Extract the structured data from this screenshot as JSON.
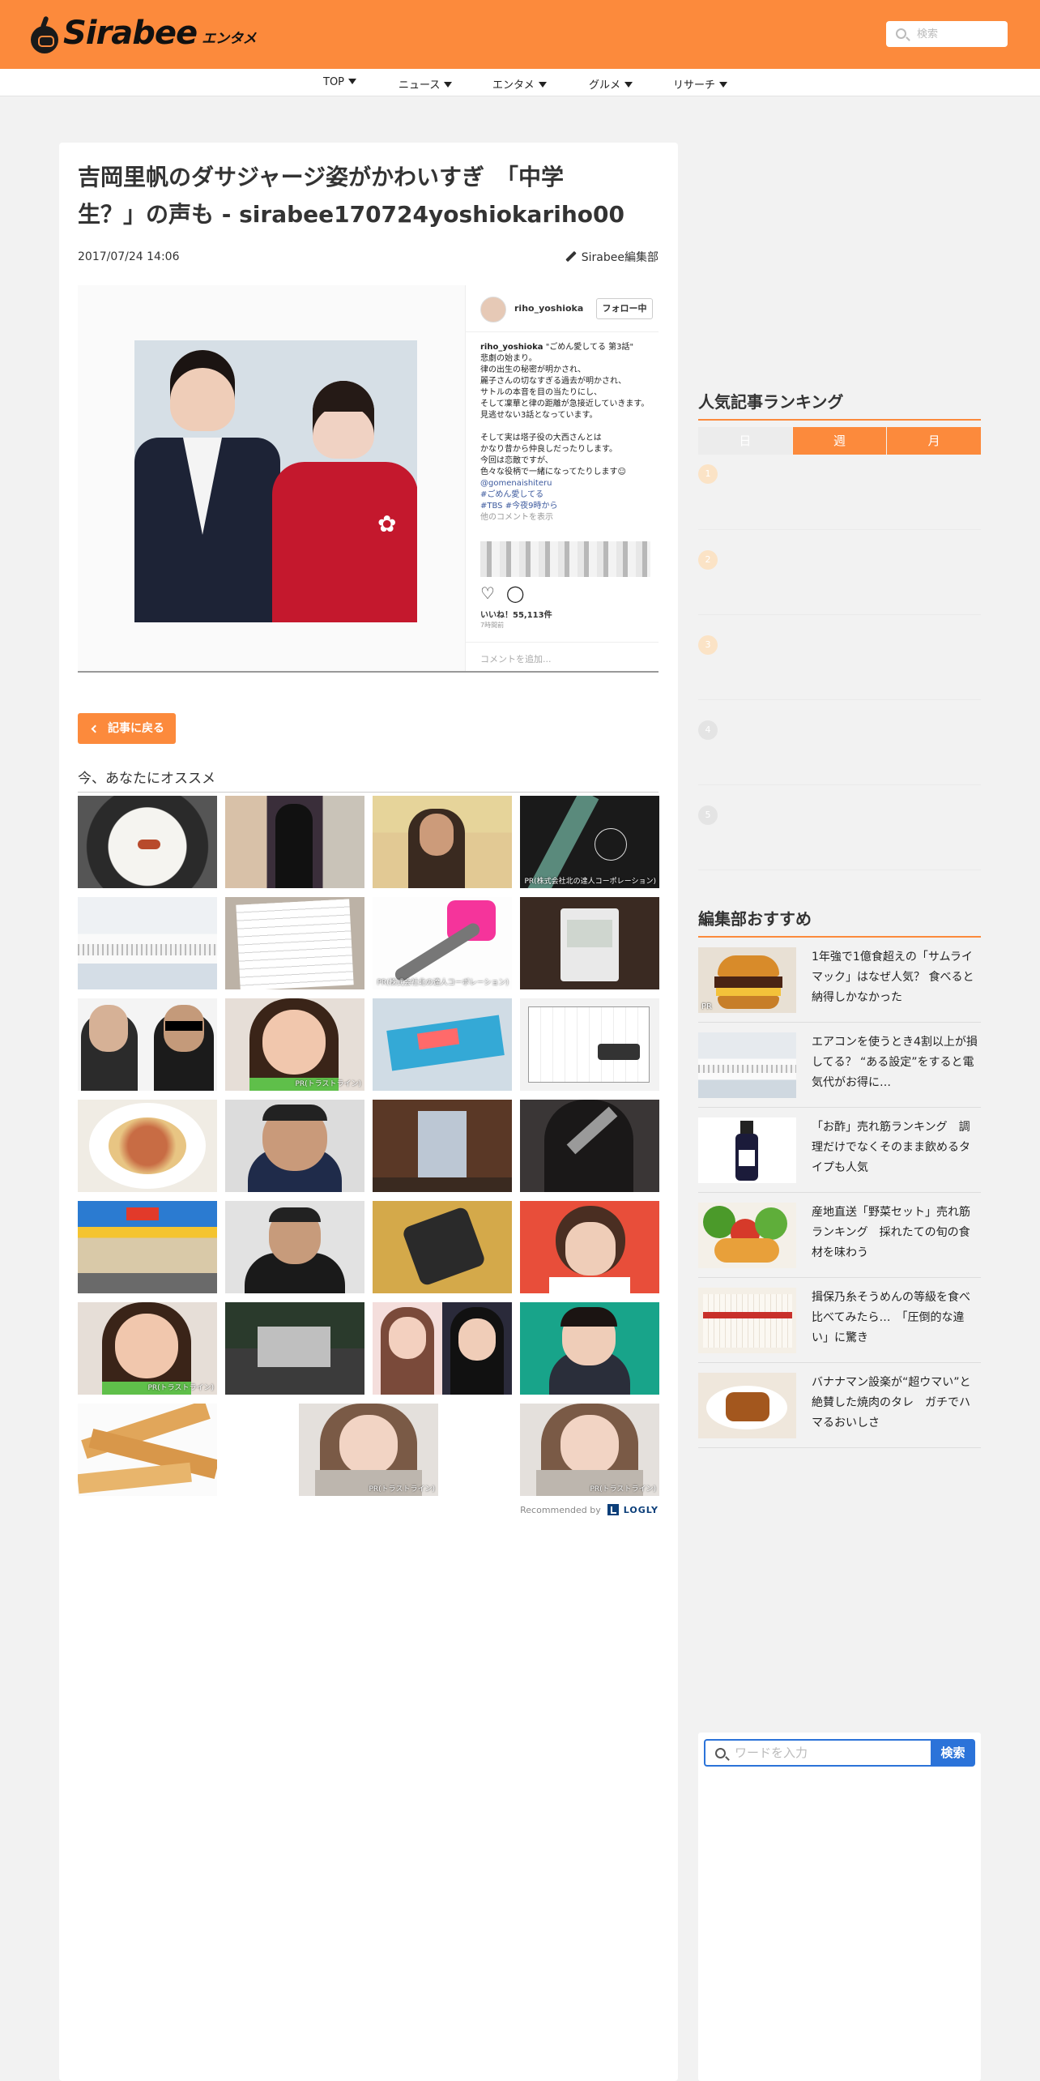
{
  "header": {
    "logo_text": "Sirabee",
    "logo_sub": "エンタメ",
    "search_placeholder": "検索"
  },
  "nav": {
    "items": [
      {
        "label": "TOP"
      },
      {
        "label": "ニュース"
      },
      {
        "label": "エンタメ"
      },
      {
        "label": "グルメ"
      },
      {
        "label": "リサーチ"
      }
    ]
  },
  "article": {
    "title_line1": "吉岡里帆のダサジャージ姿がかわいすぎ　「中学",
    "title_line2": "生？」の声も - sirabee170724yoshiokariho00",
    "date": "2017/07/24 14:06",
    "author": "Sirabee編集部",
    "instagram": {
      "username": "riho_yoshioka",
      "follow_label": "フォロー中",
      "caption_user": "riho_yoshioka",
      "caption_lines": "\"ごめん愛してる 第3話\"\n悲劇の始まり。\n律の出生の秘密が明かされ、\n麗子さんの切なすぎる過去が明かされ、\nサトルの本音を目の当たりにし、\nそして凜華と律の距離が急接近していきます。\n見逃せない3話となっています。\n\nそして実は塔子役の大西さんとは\nかなり昔から仲良しだったりします。\n今回は恋敵ですが、\n色々な役柄で一緒になってたりします☺︎",
      "caption_tags": "@gomenaishiteru\n#ごめん愛してる\n#TBS #今夜9時から",
      "more_comments": "他のコメントを表示",
      "likes": "いいね！55,113件",
      "time": "7時間前",
      "comment_placeholder": "コメントを追加..."
    },
    "back_label": "記事に戻る"
  },
  "recommend": {
    "title": "今、あなたにオススメ",
    "pr_labels": {
      "t4": "PR(株式会社北の達人コーポレーション)",
      "t11": "PR(株式会社北の達人コーポレーション)",
      "t14": "PR(トラストライン)",
      "t21": "PR(トラストライン)",
      "t23": "PR(トラストライン)",
      "t24": "PR(トラストライン)"
    },
    "powered_by": "Recommended by",
    "logly": "LOGLY"
  },
  "ranking": {
    "title": "人気記事ランキング",
    "tabs": [
      {
        "label": "日"
      },
      {
        "label": "週"
      },
      {
        "label": "月"
      }
    ],
    "numbers": [
      "1",
      "2",
      "3",
      "4",
      "5"
    ]
  },
  "picks": {
    "title": "編集部おすすめ",
    "items": [
      {
        "text": "1年強で1億食超えの「サムライマック」はなぜ人気？ 食べると納得しかなかった",
        "badge": "PR"
      },
      {
        "text": "エアコンを使うとき4割以上が損してる？ “ある設定”をすると電気代がお得に…",
        "badge": ""
      },
      {
        "text": "「お酢」売れ筋ランキング　調理だけでなくそのまま飲めるタイプも人気",
        "badge": ""
      },
      {
        "text": "産地直送「野菜セット」売れ筋ランキング　採れたての旬の食材を味わう",
        "badge": ""
      },
      {
        "text": "揖保乃糸そうめんの等級を食べ比べてみたら…　「圧倒的な違い」に驚き",
        "badge": ""
      },
      {
        "text": "バナナマン設楽が“超ウマい”と絶賛した焼肉のタレ　ガチでハマるおいしさ",
        "badge": ""
      }
    ]
  },
  "side_search": {
    "placeholder": "ワードを入力",
    "button": "検索"
  },
  "colors": {
    "brand_orange": "#fc8a3c",
    "search_blue": "#2b73d9"
  }
}
